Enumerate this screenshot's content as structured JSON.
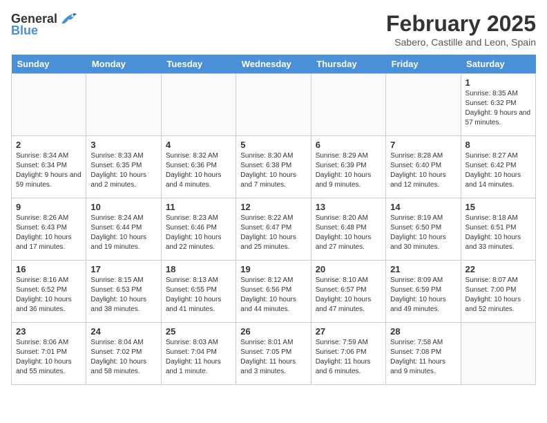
{
  "header": {
    "logo_general": "General",
    "logo_blue": "Blue",
    "title": "February 2025",
    "subtitle": "Sabero, Castille and Leon, Spain"
  },
  "weekdays": [
    "Sunday",
    "Monday",
    "Tuesday",
    "Wednesday",
    "Thursday",
    "Friday",
    "Saturday"
  ],
  "weeks": [
    [
      {
        "day": "",
        "text": ""
      },
      {
        "day": "",
        "text": ""
      },
      {
        "day": "",
        "text": ""
      },
      {
        "day": "",
        "text": ""
      },
      {
        "day": "",
        "text": ""
      },
      {
        "day": "",
        "text": ""
      },
      {
        "day": "1",
        "text": "Sunrise: 8:35 AM\nSunset: 6:32 PM\nDaylight: 9 hours and 57 minutes."
      }
    ],
    [
      {
        "day": "2",
        "text": "Sunrise: 8:34 AM\nSunset: 6:34 PM\nDaylight: 9 hours and 59 minutes."
      },
      {
        "day": "3",
        "text": "Sunrise: 8:33 AM\nSunset: 6:35 PM\nDaylight: 10 hours and 2 minutes."
      },
      {
        "day": "4",
        "text": "Sunrise: 8:32 AM\nSunset: 6:36 PM\nDaylight: 10 hours and 4 minutes."
      },
      {
        "day": "5",
        "text": "Sunrise: 8:30 AM\nSunset: 6:38 PM\nDaylight: 10 hours and 7 minutes."
      },
      {
        "day": "6",
        "text": "Sunrise: 8:29 AM\nSunset: 6:39 PM\nDaylight: 10 hours and 9 minutes."
      },
      {
        "day": "7",
        "text": "Sunrise: 8:28 AM\nSunset: 6:40 PM\nDaylight: 10 hours and 12 minutes."
      },
      {
        "day": "8",
        "text": "Sunrise: 8:27 AM\nSunset: 6:42 PM\nDaylight: 10 hours and 14 minutes."
      }
    ],
    [
      {
        "day": "9",
        "text": "Sunrise: 8:26 AM\nSunset: 6:43 PM\nDaylight: 10 hours and 17 minutes."
      },
      {
        "day": "10",
        "text": "Sunrise: 8:24 AM\nSunset: 6:44 PM\nDaylight: 10 hours and 19 minutes."
      },
      {
        "day": "11",
        "text": "Sunrise: 8:23 AM\nSunset: 6:46 PM\nDaylight: 10 hours and 22 minutes."
      },
      {
        "day": "12",
        "text": "Sunrise: 8:22 AM\nSunset: 6:47 PM\nDaylight: 10 hours and 25 minutes."
      },
      {
        "day": "13",
        "text": "Sunrise: 8:20 AM\nSunset: 6:48 PM\nDaylight: 10 hours and 27 minutes."
      },
      {
        "day": "14",
        "text": "Sunrise: 8:19 AM\nSunset: 6:50 PM\nDaylight: 10 hours and 30 minutes."
      },
      {
        "day": "15",
        "text": "Sunrise: 8:18 AM\nSunset: 6:51 PM\nDaylight: 10 hours and 33 minutes."
      }
    ],
    [
      {
        "day": "16",
        "text": "Sunrise: 8:16 AM\nSunset: 6:52 PM\nDaylight: 10 hours and 36 minutes."
      },
      {
        "day": "17",
        "text": "Sunrise: 8:15 AM\nSunset: 6:53 PM\nDaylight: 10 hours and 38 minutes."
      },
      {
        "day": "18",
        "text": "Sunrise: 8:13 AM\nSunset: 6:55 PM\nDaylight: 10 hours and 41 minutes."
      },
      {
        "day": "19",
        "text": "Sunrise: 8:12 AM\nSunset: 6:56 PM\nDaylight: 10 hours and 44 minutes."
      },
      {
        "day": "20",
        "text": "Sunrise: 8:10 AM\nSunset: 6:57 PM\nDaylight: 10 hours and 47 minutes."
      },
      {
        "day": "21",
        "text": "Sunrise: 8:09 AM\nSunset: 6:59 PM\nDaylight: 10 hours and 49 minutes."
      },
      {
        "day": "22",
        "text": "Sunrise: 8:07 AM\nSunset: 7:00 PM\nDaylight: 10 hours and 52 minutes."
      }
    ],
    [
      {
        "day": "23",
        "text": "Sunrise: 8:06 AM\nSunset: 7:01 PM\nDaylight: 10 hours and 55 minutes."
      },
      {
        "day": "24",
        "text": "Sunrise: 8:04 AM\nSunset: 7:02 PM\nDaylight: 10 hours and 58 minutes."
      },
      {
        "day": "25",
        "text": "Sunrise: 8:03 AM\nSunset: 7:04 PM\nDaylight: 11 hours and 1 minute."
      },
      {
        "day": "26",
        "text": "Sunrise: 8:01 AM\nSunset: 7:05 PM\nDaylight: 11 hours and 3 minutes."
      },
      {
        "day": "27",
        "text": "Sunrise: 7:59 AM\nSunset: 7:06 PM\nDaylight: 11 hours and 6 minutes."
      },
      {
        "day": "28",
        "text": "Sunrise: 7:58 AM\nSunset: 7:08 PM\nDaylight: 11 hours and 9 minutes."
      },
      {
        "day": "",
        "text": ""
      }
    ]
  ]
}
